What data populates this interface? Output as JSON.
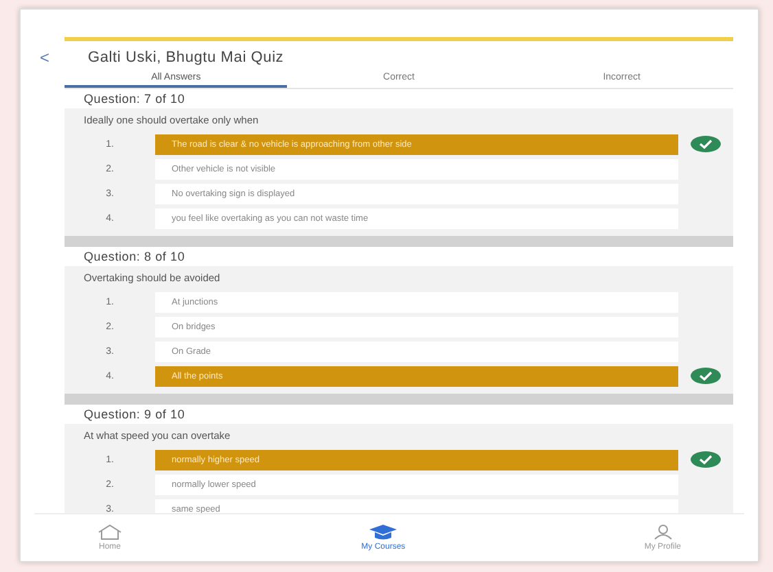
{
  "header": {
    "back": "<",
    "title": "Galti Uski, Bhugtu Mai Quiz"
  },
  "tabs": [
    {
      "label": "All Answers",
      "selected": true
    },
    {
      "label": "Correct",
      "selected": false
    },
    {
      "label": "Incorrect",
      "selected": false
    }
  ],
  "questions": [
    {
      "header": "Question: 7 of 10",
      "text": "Ideally one should overtake only when",
      "options": [
        {
          "number": "1.",
          "text": "The road is clear & no vehicle is approaching from other side",
          "selected": true
        },
        {
          "number": "2.",
          "text": "Other vehicle is not visible",
          "selected": false
        },
        {
          "number": "3.",
          "text": "No overtaking sign is displayed",
          "selected": false
        },
        {
          "number": "4.",
          "text": "you feel like overtaking as you can not waste time",
          "selected": false
        }
      ]
    },
    {
      "header": "Question: 8 of 10",
      "text": "Overtaking should be avoided",
      "options": [
        {
          "number": "1.",
          "text": "At junctions",
          "selected": false
        },
        {
          "number": "2.",
          "text": "On bridges",
          "selected": false
        },
        {
          "number": "3.",
          "text": "On Grade",
          "selected": false
        },
        {
          "number": "4.",
          "text": "All the points",
          "selected": true
        }
      ]
    },
    {
      "header": "Question: 9 of 10",
      "text": "At what speed you can overtake",
      "options": [
        {
          "number": "1.",
          "text": "normally higher speed",
          "selected": true
        },
        {
          "number": "2.",
          "text": "normally lower speed",
          "selected": false
        },
        {
          "number": "3.",
          "text": "same speed",
          "selected": false
        }
      ]
    }
  ],
  "nav": [
    {
      "kind": "home",
      "label": "Home",
      "selected": false
    },
    {
      "kind": "courses",
      "label": "My Courses",
      "selected": true
    },
    {
      "kind": "profile",
      "label": "My Profile",
      "selected": false
    }
  ]
}
